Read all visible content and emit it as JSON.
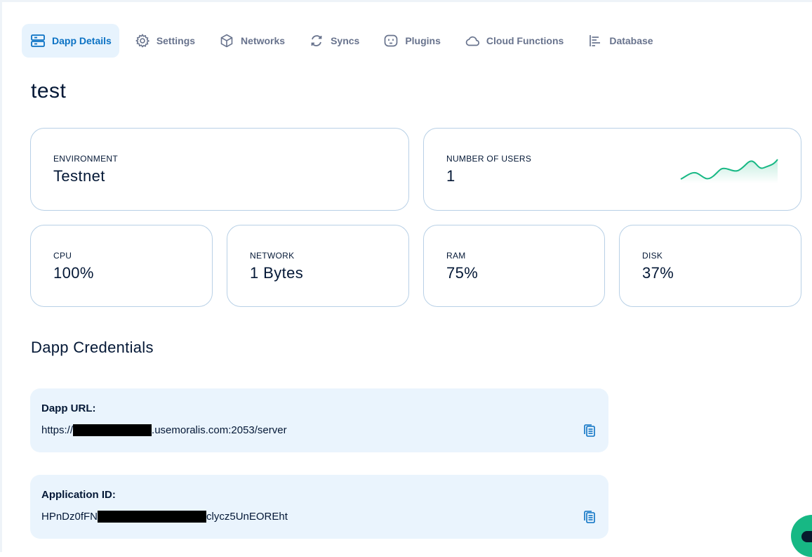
{
  "tabs": [
    {
      "label": "Dapp Details",
      "icon": "server-icon",
      "active": true
    },
    {
      "label": "Settings",
      "icon": "gear-icon",
      "active": false
    },
    {
      "label": "Networks",
      "icon": "cube-icon",
      "active": false
    },
    {
      "label": "Syncs",
      "icon": "sync-icon",
      "active": false
    },
    {
      "label": "Plugins",
      "icon": "plug-icon",
      "active": false
    },
    {
      "label": "Cloud Functions",
      "icon": "cloud-icon",
      "active": false
    },
    {
      "label": "Database",
      "icon": "database-icon",
      "active": false
    }
  ],
  "title": "test",
  "stats": {
    "environment": {
      "caption": "ENVIRONMENT",
      "value": "Testnet"
    },
    "users": {
      "caption": "NUMBER OF USERS",
      "value": "1"
    },
    "cpu": {
      "caption": "CPU",
      "value": "100%"
    },
    "network": {
      "caption": "NETWORK",
      "value": "1 Bytes"
    },
    "ram": {
      "caption": "RAM",
      "value": "75%"
    },
    "disk": {
      "caption": "DISK",
      "value": "37%"
    }
  },
  "credentials": {
    "title": "Dapp Credentials",
    "url": {
      "label": "Dapp URL:",
      "prefix": "https://",
      "suffix": ".usemoralis.com:2053/server"
    },
    "app_id": {
      "label": "Application ID:",
      "prefix": "HPnDz0fFN",
      "suffix": "clycz5UnEOREht"
    }
  },
  "colors": {
    "accent": "#0b72c4",
    "accent_bg": "#e7f3fd",
    "sparkline": "#17b884",
    "fab": "#17b884"
  }
}
